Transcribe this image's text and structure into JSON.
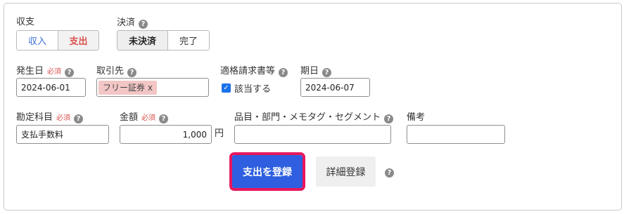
{
  "income_expense": {
    "label": "収支",
    "options": [
      "収入",
      "支出"
    ],
    "selected": "支出"
  },
  "settlement": {
    "label": "決済",
    "options": [
      "未決済",
      "完了"
    ],
    "selected": "未決済"
  },
  "occurrence_date": {
    "label": "発生日",
    "required": "必須",
    "value": "2024-06-01"
  },
  "partner": {
    "label": "取引先",
    "tag": "フリー証券",
    "tag_remove": "x"
  },
  "qualified_invoice": {
    "label": "適格請求書等",
    "checkbox_label": "該当する",
    "checked": true
  },
  "due_date": {
    "label": "期日",
    "value": "2024-06-07"
  },
  "account_item": {
    "label": "勘定科目",
    "required": "必須",
    "value": "支払手数料"
  },
  "amount": {
    "label": "金額",
    "required": "必須",
    "value": "1,000",
    "unit": "円"
  },
  "segments": {
    "label": "品目・部門・メモタグ・セグメント",
    "value": ""
  },
  "remarks": {
    "label": "備考",
    "value": ""
  },
  "actions": {
    "register_expense": "支出を登録",
    "detailed_register": "詳細登録"
  },
  "help_glyph": "?",
  "colors": {
    "primary": "#2f5fe0",
    "highlight_border": "#e8175d",
    "income_text": "#3c6fd6",
    "expense_text": "#d9534f",
    "required": "#d9534f",
    "tag_bg": "#f3c6c6"
  }
}
